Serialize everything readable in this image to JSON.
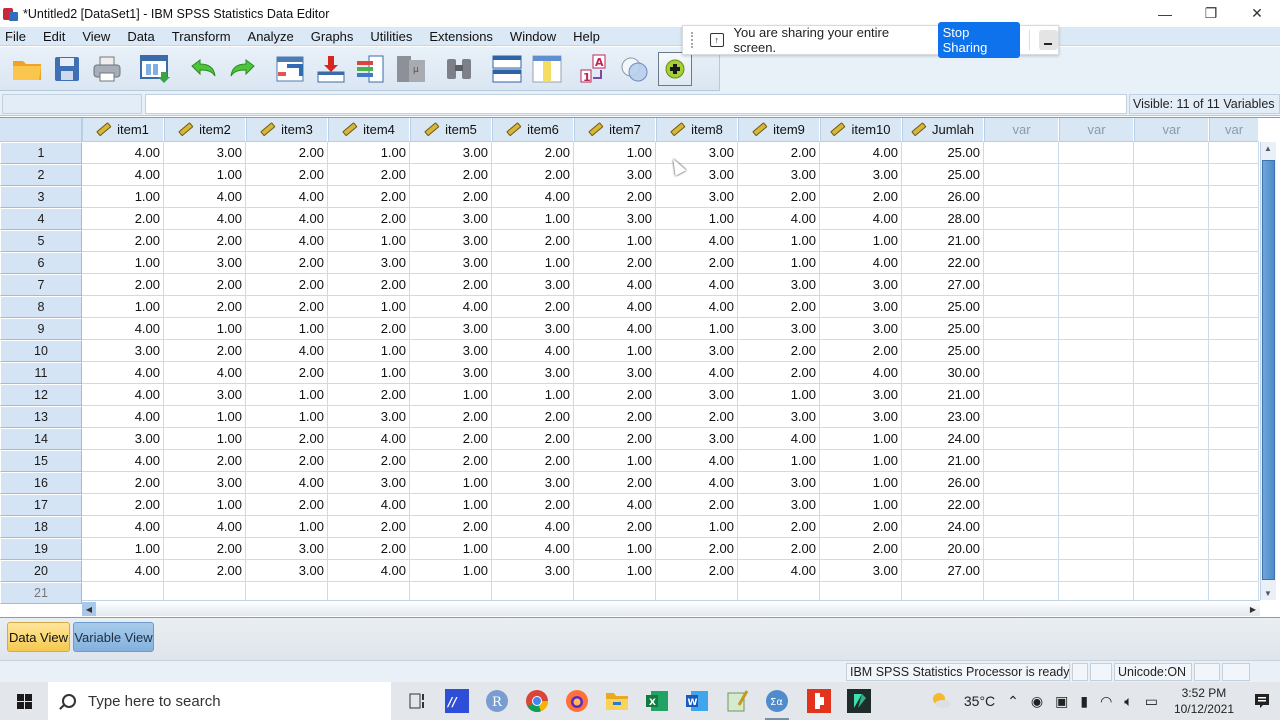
{
  "window": {
    "title": "*Untitled2 [DataSet1] - IBM SPSS Statistics Data Editor",
    "controls": {
      "minimize": "—",
      "restore": "❐",
      "close": "✕"
    }
  },
  "menu": [
    {
      "label": "File"
    },
    {
      "label": "Edit"
    },
    {
      "label": "View"
    },
    {
      "label": "Data"
    },
    {
      "label": "Transform"
    },
    {
      "label": "Analyze"
    },
    {
      "label": "Graphs"
    },
    {
      "label": "Utilities"
    },
    {
      "label": "Extensions"
    },
    {
      "label": "Window"
    },
    {
      "label": "Help"
    }
  ],
  "toolbar": {
    "icons": [
      "open-folder-icon",
      "save-icon",
      "print-icon",
      "dialog-recall-icon",
      "undo-icon",
      "redo-icon",
      "goto-case-icon",
      "goto-variable-icon",
      "variables-icon",
      "run-descriptives-icon",
      "find-icon",
      "insert-cases-icon",
      "insert-variable-icon",
      "value-labels-icon",
      "use-variable-sets-icon",
      "customize-icon"
    ]
  },
  "share_banner": {
    "text": "You are sharing your entire screen.",
    "stop_label": "Stop Sharing",
    "minimize_label": "_"
  },
  "refbar": {
    "cell_ref": "",
    "cell_value": "",
    "visible": "Visible: 11 of 11 Variables"
  },
  "grid": {
    "columns": [
      "item1",
      "item2",
      "item3",
      "item4",
      "item5",
      "item6",
      "item7",
      "item8",
      "item9",
      "item10",
      "Jumlah"
    ],
    "empty_columns": [
      "var",
      "var",
      "var",
      "var"
    ],
    "rows": [
      [
        "4.00",
        "3.00",
        "2.00",
        "1.00",
        "3.00",
        "2.00",
        "1.00",
        "3.00",
        "2.00",
        "4.00",
        "25.00"
      ],
      [
        "4.00",
        "1.00",
        "2.00",
        "2.00",
        "2.00",
        "2.00",
        "3.00",
        "3.00",
        "3.00",
        "3.00",
        "25.00"
      ],
      [
        "1.00",
        "4.00",
        "4.00",
        "2.00",
        "2.00",
        "4.00",
        "2.00",
        "3.00",
        "2.00",
        "2.00",
        "26.00"
      ],
      [
        "2.00",
        "4.00",
        "4.00",
        "2.00",
        "3.00",
        "1.00",
        "3.00",
        "1.00",
        "4.00",
        "4.00",
        "28.00"
      ],
      [
        "2.00",
        "2.00",
        "4.00",
        "1.00",
        "3.00",
        "2.00",
        "1.00",
        "4.00",
        "1.00",
        "1.00",
        "21.00"
      ],
      [
        "1.00",
        "3.00",
        "2.00",
        "3.00",
        "3.00",
        "1.00",
        "2.00",
        "2.00",
        "1.00",
        "4.00",
        "22.00"
      ],
      [
        "2.00",
        "2.00",
        "2.00",
        "2.00",
        "2.00",
        "3.00",
        "4.00",
        "4.00",
        "3.00",
        "3.00",
        "27.00"
      ],
      [
        "1.00",
        "2.00",
        "2.00",
        "1.00",
        "4.00",
        "2.00",
        "4.00",
        "4.00",
        "2.00",
        "3.00",
        "25.00"
      ],
      [
        "4.00",
        "1.00",
        "1.00",
        "2.00",
        "3.00",
        "3.00",
        "4.00",
        "1.00",
        "3.00",
        "3.00",
        "25.00"
      ],
      [
        "3.00",
        "2.00",
        "4.00",
        "1.00",
        "3.00",
        "4.00",
        "1.00",
        "3.00",
        "2.00",
        "2.00",
        "25.00"
      ],
      [
        "4.00",
        "4.00",
        "2.00",
        "1.00",
        "3.00",
        "3.00",
        "3.00",
        "4.00",
        "2.00",
        "4.00",
        "30.00"
      ],
      [
        "4.00",
        "3.00",
        "1.00",
        "2.00",
        "1.00",
        "1.00",
        "2.00",
        "3.00",
        "1.00",
        "3.00",
        "21.00"
      ],
      [
        "4.00",
        "1.00",
        "1.00",
        "3.00",
        "2.00",
        "2.00",
        "2.00",
        "2.00",
        "3.00",
        "3.00",
        "23.00"
      ],
      [
        "3.00",
        "1.00",
        "2.00",
        "4.00",
        "2.00",
        "2.00",
        "2.00",
        "3.00",
        "4.00",
        "1.00",
        "24.00"
      ],
      [
        "4.00",
        "2.00",
        "2.00",
        "2.00",
        "2.00",
        "2.00",
        "1.00",
        "4.00",
        "1.00",
        "1.00",
        "21.00"
      ],
      [
        "2.00",
        "3.00",
        "4.00",
        "3.00",
        "1.00",
        "3.00",
        "2.00",
        "4.00",
        "3.00",
        "1.00",
        "26.00"
      ],
      [
        "2.00",
        "1.00",
        "2.00",
        "4.00",
        "1.00",
        "2.00",
        "4.00",
        "2.00",
        "3.00",
        "1.00",
        "22.00"
      ],
      [
        "4.00",
        "4.00",
        "1.00",
        "2.00",
        "2.00",
        "4.00",
        "2.00",
        "1.00",
        "2.00",
        "2.00",
        "24.00"
      ],
      [
        "1.00",
        "2.00",
        "3.00",
        "2.00",
        "1.00",
        "4.00",
        "1.00",
        "2.00",
        "2.00",
        "2.00",
        "20.00"
      ],
      [
        "4.00",
        "2.00",
        "3.00",
        "4.00",
        "1.00",
        "3.00",
        "1.00",
        "2.00",
        "4.00",
        "3.00",
        "27.00"
      ]
    ],
    "next_row_number": "21"
  },
  "tabs": [
    {
      "label": "Data View",
      "active": true
    },
    {
      "label": "Variable View",
      "active": false
    }
  ],
  "status": {
    "processor": "IBM SPSS Statistics Processor is ready",
    "unicode": "Unicode:ON"
  },
  "taskbar": {
    "search_placeholder": "Type here to search",
    "weather": "35°C",
    "time": "3:52 PM",
    "date": "10/12/2021",
    "apps": [
      "task-view-icon",
      "app-mathtype-icon",
      "r-icon",
      "chrome-icon",
      "firefox-icon",
      "file-explorer-icon",
      "excel-icon",
      "word-icon",
      "notepad-icon",
      "spss-icon",
      "pdf-reader-icon",
      "filmora-icon"
    ]
  },
  "colors": {
    "accent": "#0e72ed",
    "header_bg": "#d9e7f5",
    "active_tab": "#f5c94f",
    "inactive_tab": "#83b1dd"
  }
}
